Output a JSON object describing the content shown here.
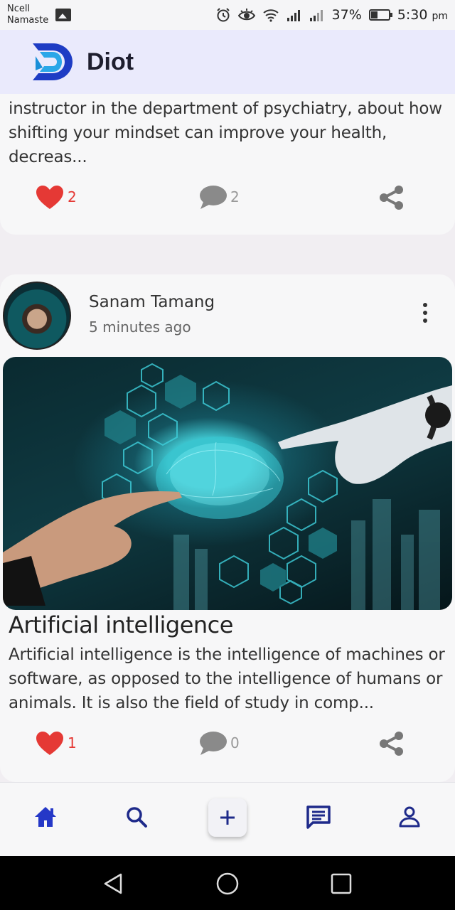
{
  "status_bar": {
    "carrier_line1": "Ncell",
    "carrier_line2": "Namaste",
    "battery_percent": "37%",
    "time": "5:30",
    "time_suffix": "pm",
    "icons": [
      "gallery-icon",
      "alarm-icon",
      "eye-icon",
      "wifi-icon",
      "signal-icon",
      "signal-icon",
      "battery-icon"
    ]
  },
  "header": {
    "app_name": "Diot",
    "logo": "diot-logo"
  },
  "posts": [
    {
      "excerpt": "instructor in the department of psychiatry, about how shifting your mindset can improve your health, decreas...",
      "likes": "2",
      "comments": "2"
    },
    {
      "author": "Sanam Tamang",
      "time_ago": "5 minutes ago",
      "title": "Artificial intelligence",
      "excerpt": "Artificial intelligence is the intelligence of machines or software, as opposed to the intelligence of humans or animals. It is also the field of study in comp...",
      "likes": "1",
      "comments": "0",
      "image": "ai-brain-robot-hand-image"
    }
  ],
  "bottom_nav": {
    "items": [
      "home-icon",
      "search-icon",
      "add-icon",
      "chat-icon",
      "profile-icon"
    ]
  },
  "colors": {
    "accent": "#2538c7",
    "like": "#e53935",
    "header_bg": "#eaeafc",
    "nav_icon": "#1e2a8a"
  }
}
